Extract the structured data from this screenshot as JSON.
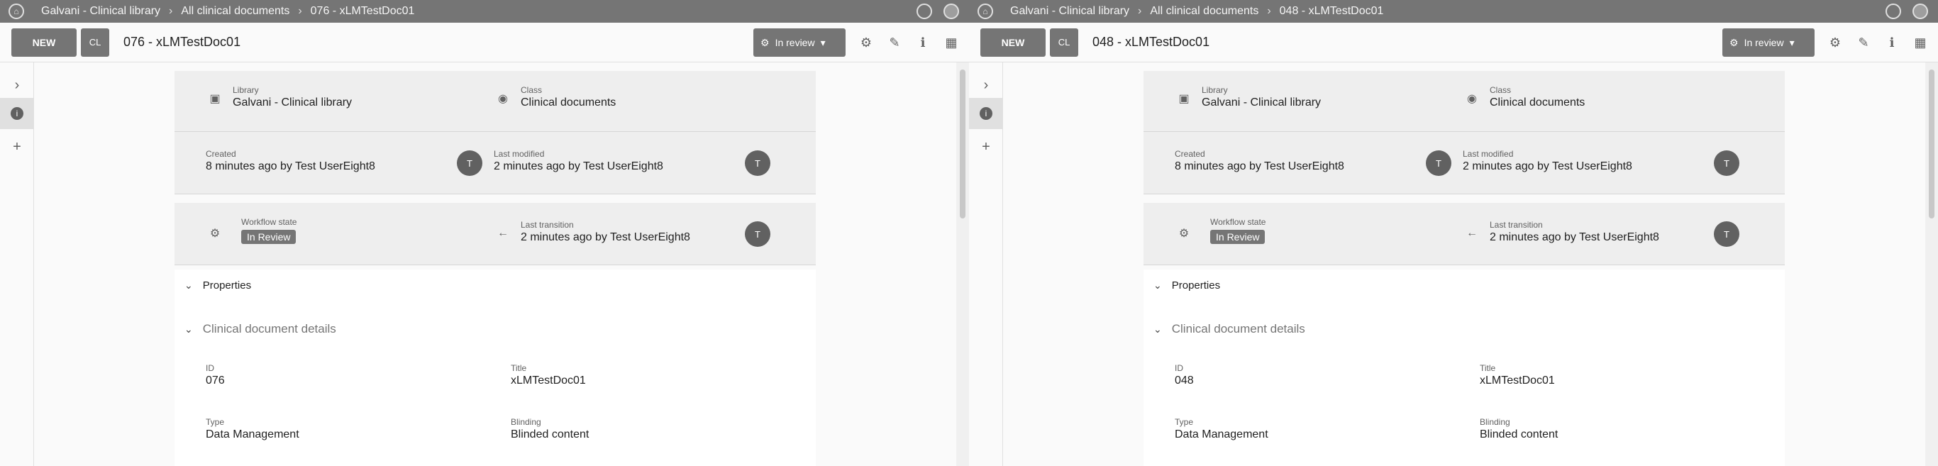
{
  "panes": [
    {
      "breadcrumb": [
        "Galvani - Clinical library",
        "All clinical documents",
        "076 - xLMTestDoc01"
      ],
      "toolbar": {
        "new_label": "NEW",
        "ctx_label": "CL",
        "title": "076 - xLMTestDoc01",
        "review_label": "In review"
      },
      "summary": {
        "library": {
          "label": "Library",
          "value": "Galvani - Clinical library"
        },
        "class": {
          "label": "Class",
          "value": "Clinical documents"
        },
        "created": {
          "label": "Created",
          "value": "8 minutes ago by Test UserEight8",
          "avatar": "T"
        },
        "last_modified": {
          "label": "Last modified",
          "value": "2 minutes ago by Test UserEight8",
          "avatar": "T"
        },
        "workflow_state": {
          "label": "Workflow state",
          "value": "In Review"
        },
        "last_transition": {
          "label": "Last transition",
          "value": "2 minutes ago by Test UserEight8",
          "avatar": "T"
        }
      },
      "properties": {
        "heading": "Properties",
        "sub_heading": "Clinical document details",
        "fields": [
          {
            "label": "ID",
            "value": "076"
          },
          {
            "label": "Title",
            "value": "xLMTestDoc01"
          },
          {
            "label": "Type",
            "value": "Data Management"
          },
          {
            "label": "Blinding",
            "value": "Blinded content"
          }
        ]
      }
    },
    {
      "breadcrumb": [
        "Galvani - Clinical library",
        "All clinical documents",
        "048 - xLMTestDoc01"
      ],
      "toolbar": {
        "new_label": "NEW",
        "ctx_label": "CL",
        "title": "048 - xLMTestDoc01",
        "review_label": "In review"
      },
      "summary": {
        "library": {
          "label": "Library",
          "value": "Galvani - Clinical library"
        },
        "class": {
          "label": "Class",
          "value": "Clinical documents"
        },
        "created": {
          "label": "Created",
          "value": "8 minutes ago by Test UserEight8",
          "avatar": "T"
        },
        "last_modified": {
          "label": "Last modified",
          "value": "2 minutes ago by Test UserEight8",
          "avatar": "T"
        },
        "workflow_state": {
          "label": "Workflow state",
          "value": "In Review"
        },
        "last_transition": {
          "label": "Last transition",
          "value": "2 minutes ago by Test UserEight8",
          "avatar": "T"
        }
      },
      "properties": {
        "heading": "Properties",
        "sub_heading": "Clinical document details",
        "fields": [
          {
            "label": "ID",
            "value": "048"
          },
          {
            "label": "Title",
            "value": "xLMTestDoc01"
          },
          {
            "label": "Type",
            "value": "Data Management"
          },
          {
            "label": "Blinding",
            "value": "Blinded content"
          }
        ]
      }
    }
  ],
  "icons": {
    "home": "home-icon",
    "notifications": "bell-icon",
    "ctx": "document-class-icon",
    "review_state": "workflow-icon",
    "settings": "gear-icon",
    "edit": "pencil-icon",
    "info": "info-icon",
    "layout": "layout-icon",
    "expand": "chevron-right-icon",
    "add": "plus-icon",
    "library": "library-icon",
    "class": "class-icon",
    "workflow": "workflow-icon",
    "transition": "arrow-left-icon"
  },
  "colors": {
    "topbar": "#757575",
    "button": "#757575",
    "card": "#eeeeee"
  }
}
